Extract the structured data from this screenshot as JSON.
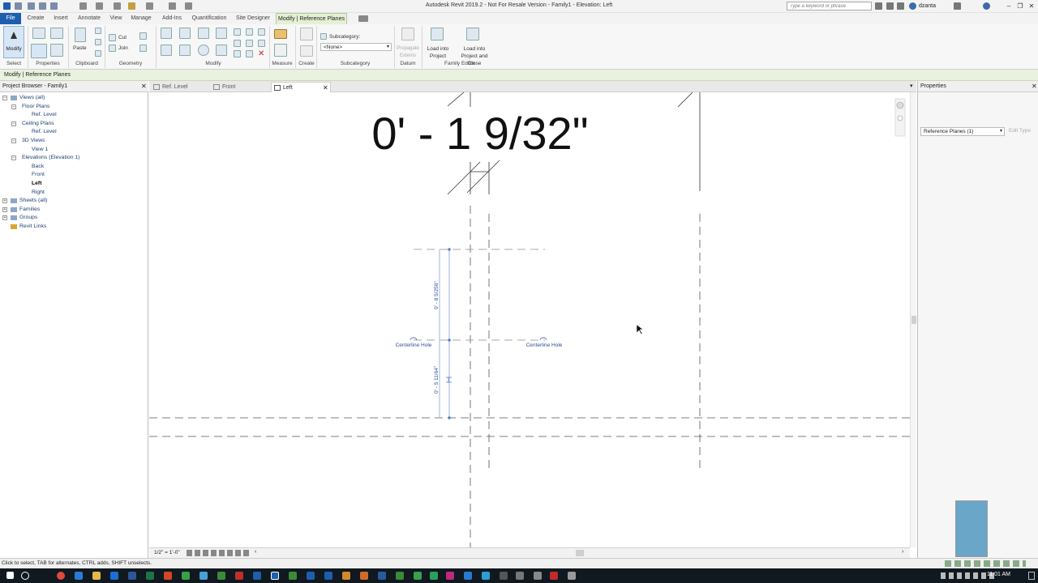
{
  "window": {
    "title": "Autodesk Revit 2019.2 - Not For Resale Version - Family1 - Elevation: Left",
    "search_placeholder": "Type a keyword or phrase",
    "user": "dzanta"
  },
  "ribbon": {
    "tabs": [
      "File",
      "Create",
      "Insert",
      "Annotate",
      "View",
      "Manage",
      "Add-Ins",
      "Quantification",
      "Site Designer",
      "Modify | Reference Planes"
    ],
    "active_tab": "Modify | Reference Planes",
    "panels": [
      "Select",
      "Properties",
      "Clipboard",
      "Geometry",
      "Modify",
      "Measure",
      "Create",
      "Subcategory",
      "Datum",
      "Family Editor"
    ],
    "modify_label": "Modify",
    "paste_label": "Paste",
    "cut_label": "Cut",
    "join_label": "Join",
    "subcategory_label": "Subcategory:",
    "subcategory_value": "<None>",
    "propagate_label": "Propagate Extents",
    "load_project_label": "Load into Project",
    "load_close_label": "Load into Project and Close"
  },
  "options_bar": {
    "context": "Modify | Reference Planes"
  },
  "project_browser": {
    "title": "Project Browser - Family1",
    "items": [
      {
        "label": "Views (all)",
        "level": 0
      },
      {
        "label": "Floor Plans",
        "level": 1
      },
      {
        "label": "Ref. Level",
        "level": 2
      },
      {
        "label": "Ceiling Plans",
        "level": 1
      },
      {
        "label": "Ref. Level",
        "level": 2
      },
      {
        "label": "3D Views",
        "level": 1
      },
      {
        "label": "View 1",
        "level": 2
      },
      {
        "label": "Elevations (Elevation 1)",
        "level": 1
      },
      {
        "label": "Back",
        "level": 2
      },
      {
        "label": "Front",
        "level": 2
      },
      {
        "label": "Left",
        "level": 2
      },
      {
        "label": "Right",
        "level": 2
      },
      {
        "label": "Sheets (all)",
        "level": 0
      },
      {
        "label": "Families",
        "level": 0
      },
      {
        "label": "Groups",
        "level": 0
      },
      {
        "label": "Revit Links",
        "level": 0
      }
    ],
    "selected": "Left"
  },
  "view_tabs": [
    {
      "label": "Ref. Level",
      "active": false
    },
    {
      "label": "Front",
      "active": false
    },
    {
      "label": "Left",
      "active": true
    }
  ],
  "drawing": {
    "temp_dimension": "0' - 1 9/32\"",
    "dim_upper": "0' - 8 5/256\"",
    "dim_lower": "0' - 5 11/64\"",
    "label_left": "Centerline Hole",
    "label_right": "Centerline Hole"
  },
  "view_control": {
    "scale": "1/2\" = 1'-0\""
  },
  "properties": {
    "title": "Properties",
    "type_selector": "Reference Planes (1)",
    "edit_type": "Edit Type"
  },
  "status_bar": {
    "text": "Click to select, TAB for alternates, CTRL adds, SHIFT unselects."
  },
  "taskbar": {
    "clock": "11:01 AM"
  },
  "colors": {
    "file_tab": "#1d5fae",
    "context_tab": "#e4f0d4",
    "selection_blue": "#5a7fc0",
    "ref_plane_green": "#7fa07f"
  }
}
